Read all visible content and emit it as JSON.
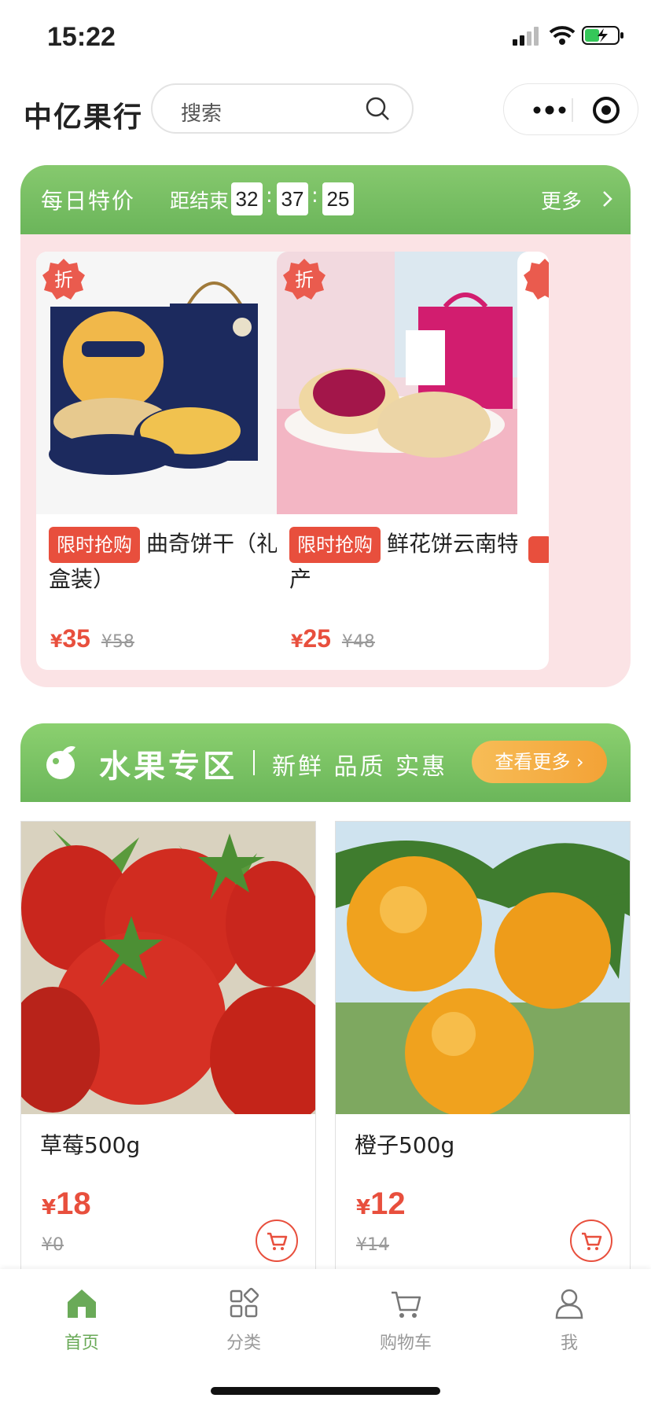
{
  "status_bar": {
    "time": "15:22"
  },
  "header": {
    "shop_name": "中亿果行",
    "search_placeholder": "搜索"
  },
  "daily_deal": {
    "title": "每日特价",
    "countdown_label": "距结束",
    "countdown": {
      "h": "32",
      "m": "37",
      "s": "25"
    },
    "more_label": "更多",
    "discount_badge": "折",
    "items": [
      {
        "tag": "限时抢购",
        "title": "曲奇饼干（礼盒装）",
        "yen": "¥",
        "price": "35",
        "old_price": "¥58"
      },
      {
        "tag": "限时抢购",
        "title": "鲜花饼云南特产",
        "yen": "¥",
        "price": "25",
        "old_price": "¥48"
      }
    ]
  },
  "fruit_zone": {
    "title": "水果专区",
    "subtitle": "新鲜 品质 实惠",
    "more_button": "查看更多 ›",
    "products": [
      {
        "name": "草莓500g",
        "yen": "¥",
        "price": "18",
        "old_price": "¥0"
      },
      {
        "name": "橙子500g",
        "yen": "¥",
        "price": "12",
        "old_price": "¥14"
      }
    ]
  },
  "tabbar": {
    "items": [
      {
        "label": "首页",
        "icon": "home-icon",
        "active": true
      },
      {
        "label": "分类",
        "icon": "grid-icon"
      },
      {
        "label": "购物车",
        "icon": "cart-icon"
      },
      {
        "label": "我",
        "icon": "user-icon"
      }
    ]
  },
  "colors": {
    "green": "#6bb55a",
    "red": "#e84f3d",
    "deal_bg": "#fbe3e5",
    "orange": "#f3a236"
  }
}
